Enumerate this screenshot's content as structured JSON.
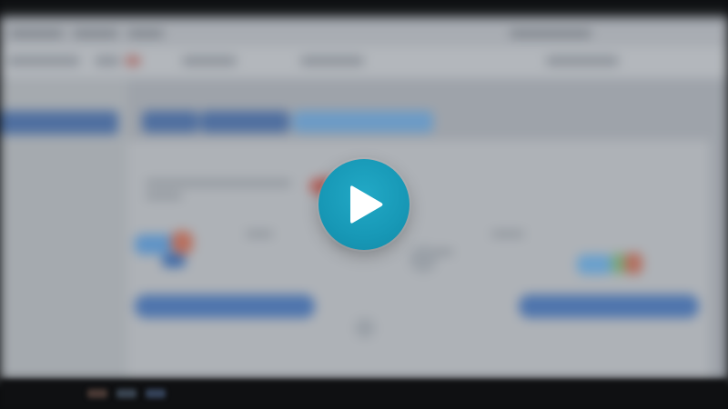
{
  "video": {
    "overlay": {
      "control": "play",
      "icon": "play-icon",
      "accent_color": "#1a9fbf",
      "icon_color": "#ffffff"
    },
    "frame": {
      "blurred": true,
      "accent_blue": "#4f6fa0",
      "accent_light_blue": "#6c9bc6",
      "accent_red": "#b5645e"
    }
  }
}
